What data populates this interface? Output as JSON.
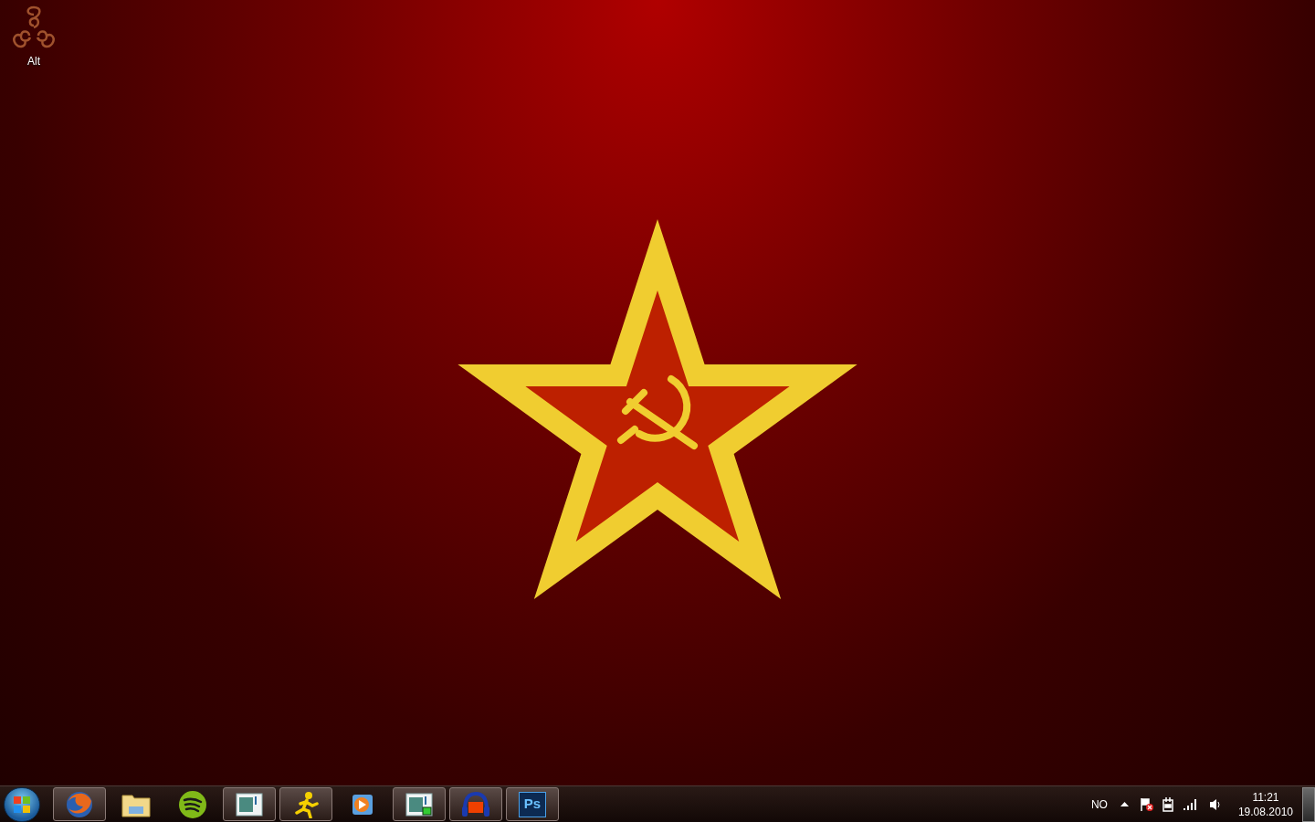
{
  "desktop": {
    "icons": [
      {
        "label": "Alt"
      }
    ]
  },
  "taskbar": {
    "items": [
      {
        "kind": "browser",
        "running": true
      },
      {
        "kind": "folder",
        "running": false
      },
      {
        "kind": "music",
        "running": false
      },
      {
        "kind": "window",
        "running": true
      },
      {
        "kind": "runner",
        "running": true
      },
      {
        "kind": "player",
        "running": false
      },
      {
        "kind": "window-green",
        "running": true
      },
      {
        "kind": "headphones",
        "running": true
      },
      {
        "kind": "ps",
        "running": true,
        "text": "Ps"
      }
    ],
    "tray": {
      "language": "NO",
      "time": "11:21",
      "date": "19.08.2010"
    }
  }
}
